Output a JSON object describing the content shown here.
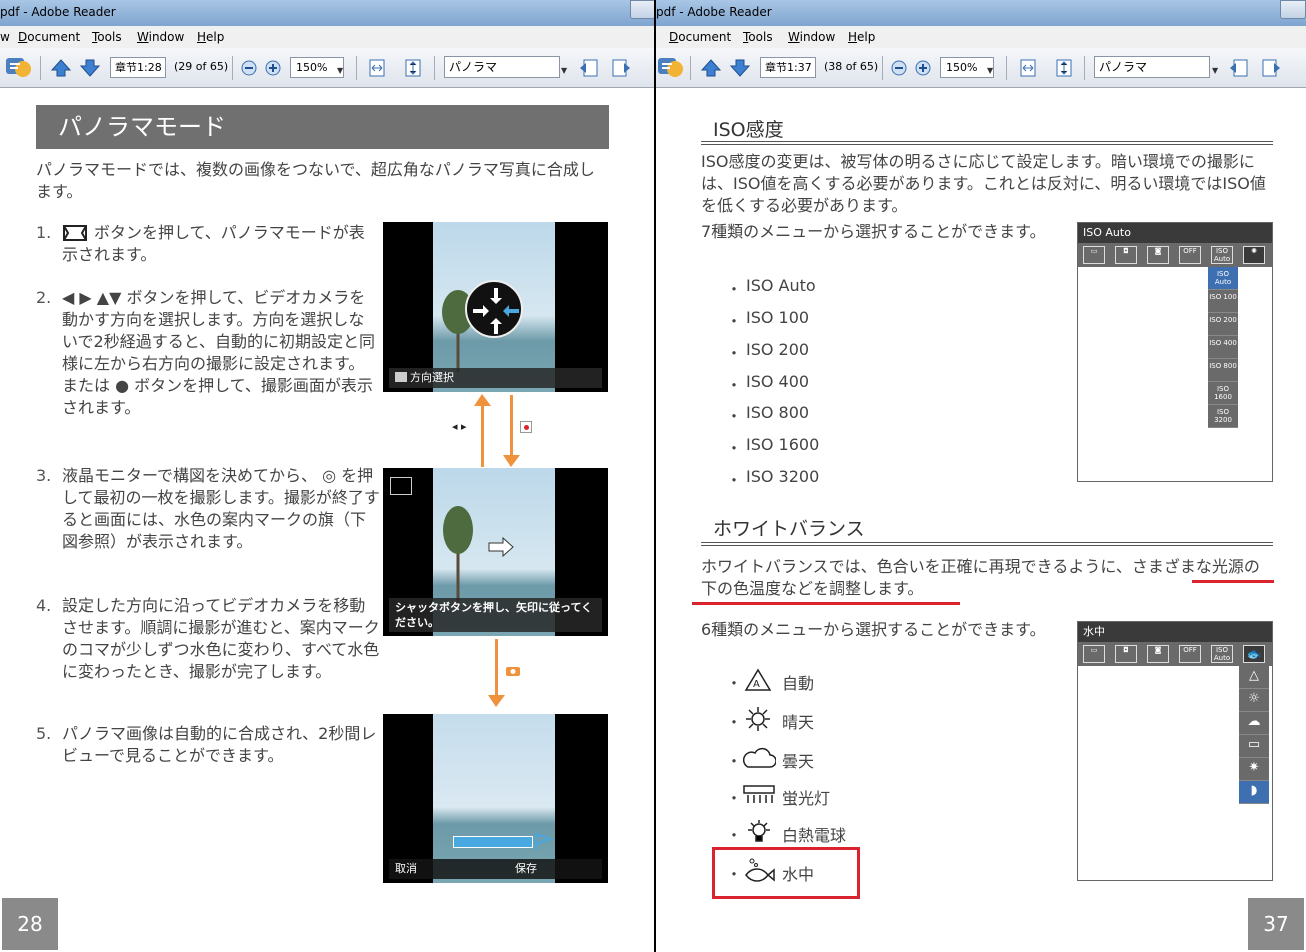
{
  "left": {
    "title": "pdf - Adobe Reader",
    "menu": [
      {
        "label": "w"
      },
      {
        "label": "Document",
        "ul": "D"
      },
      {
        "label": "Tools",
        "ul": "T"
      },
      {
        "label": "Window",
        "ul": "W"
      },
      {
        "label": "Help",
        "ul": "H"
      }
    ],
    "page_field": "章节1:28",
    "page_count": "(29 of 65)",
    "zoom": "150%",
    "search": "パノラマ",
    "heading": "パノラマモード",
    "intro": "パノラマモードでは、複数の画像をつないで、超広角なパノラマ写真に合成します。",
    "steps": [
      {
        "num": "1.",
        "text": "ボタンを押して、パノラマモードが表示されます。"
      },
      {
        "num": "2.",
        "text": "◀ ▶ ▲▼ ボタンを押して、ビデオカメラを動かす方向を選択します。方向を選択しないで2秒経過すると、自動的に初期設定と同様に左から右方向の撮影に設定されます。または ● ボタンを押して、撮影画面が表示されます。"
      },
      {
        "num": "3.",
        "text": "液晶モニターで構図を決めてから、 ◎ を押して最初の一枚を撮影します。撮影が終了すると画面には、水色の案内マークの旗（下図参照）が表示されます。"
      },
      {
        "num": "4.",
        "text": "設定した方向に沿ってビデオカメラを移動させます。順調に撮影が進むと、案内マークのコマが少しずつ水色に変わり、すべて水色に変わったとき、撮影が完了します。"
      },
      {
        "num": "5.",
        "text": "パノラマ画像は自動的に合成され、2秒間レビューで見ることができます。"
      }
    ],
    "shot1_osd": "方向選択",
    "shot2_osd": "シャッタボタンを押し、矢印に従ってください。",
    "shot3_cancel": "取消",
    "shot3_save": "保存",
    "lr_label": "◂ ▸",
    "page_number": "28"
  },
  "right": {
    "title": "pdf - Adobe Reader",
    "menu": [
      {
        "label": "Document",
        "ul": "D"
      },
      {
        "label": "Tools",
        "ul": "T"
      },
      {
        "label": "Window",
        "ul": "W"
      },
      {
        "label": "Help",
        "ul": "H"
      }
    ],
    "page_field": "章节1:37",
    "page_count": "(38 of 65)",
    "zoom": "150%",
    "search": "パノラマ",
    "iso": {
      "heading": "ISO感度",
      "desc": "ISO感度の変更は、被写体の明るさに応じて設定します。暗い環境での撮影には、ISO値を高くする必要があります。これとは反対に、明るい環境ではISO値を低くする必要があります。",
      "menu_count": "7種類のメニューから選択することができます。",
      "items": [
        "ISO Auto",
        "ISO 100",
        "ISO 200",
        "ISO 400",
        "ISO 800",
        "ISO 1600",
        "ISO 3200"
      ],
      "panel_title": "ISO Auto",
      "list_labels": [
        "ISO Auto",
        "ISO 100",
        "ISO 200",
        "ISO 400",
        "ISO 800",
        "ISO 1600",
        "ISO 3200"
      ]
    },
    "wb": {
      "heading": "ホワイトバランス",
      "desc": "ホワイトバランスでは、色合いを正確に再現できるように、さまざまな光源の下の色温度などを調整します。",
      "menu_count": "6種類のメニューから選択することができます。",
      "items": [
        "自動",
        "晴天",
        "曇天",
        "蛍光灯",
        "白熱電球",
        "水中"
      ],
      "panel_title": "水中"
    },
    "tab_icons": [
      "ISO Auto",
      "OFF"
    ],
    "page_number": "37",
    "accent_red": "#d9232e",
    "accent_orange": "#f0913d",
    "select_blue": "#3e6fb0"
  }
}
